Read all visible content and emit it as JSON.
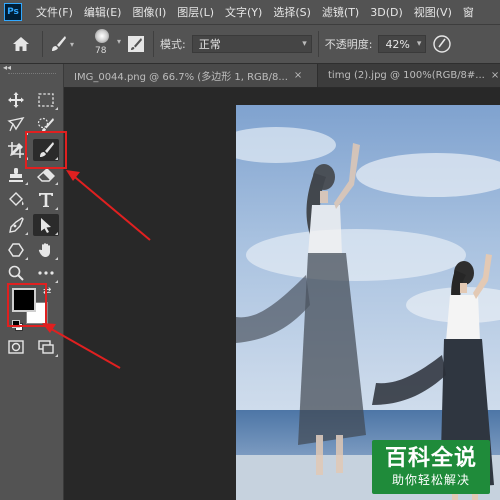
{
  "app": {
    "logo": "Ps"
  },
  "menu": [
    "文件(F)",
    "编辑(E)",
    "图像(I)",
    "图层(L)",
    "文字(Y)",
    "选择(S)",
    "滤镜(T)",
    "3D(D)",
    "视图(V)",
    "窗"
  ],
  "options": {
    "brush_size": "78",
    "mode_label": "模式:",
    "mode_value": "正常",
    "opacity_label": "不透明度:",
    "opacity_value": "42%"
  },
  "tabs": [
    {
      "label": "IMG_0044.png @ 66.7% (多边形 1, RGB/8...",
      "close": "×"
    },
    {
      "label": "timg (2).jpg @ 100%(RGB/8#...",
      "close": "×"
    }
  ],
  "watermark": {
    "title": "百科全说",
    "subtitle": "助你轻松解决"
  },
  "colors": {
    "accent_red": "#e02020",
    "watermark_green": "#1f8b3a",
    "foreground": "#000000",
    "background": "#ffffff"
  }
}
